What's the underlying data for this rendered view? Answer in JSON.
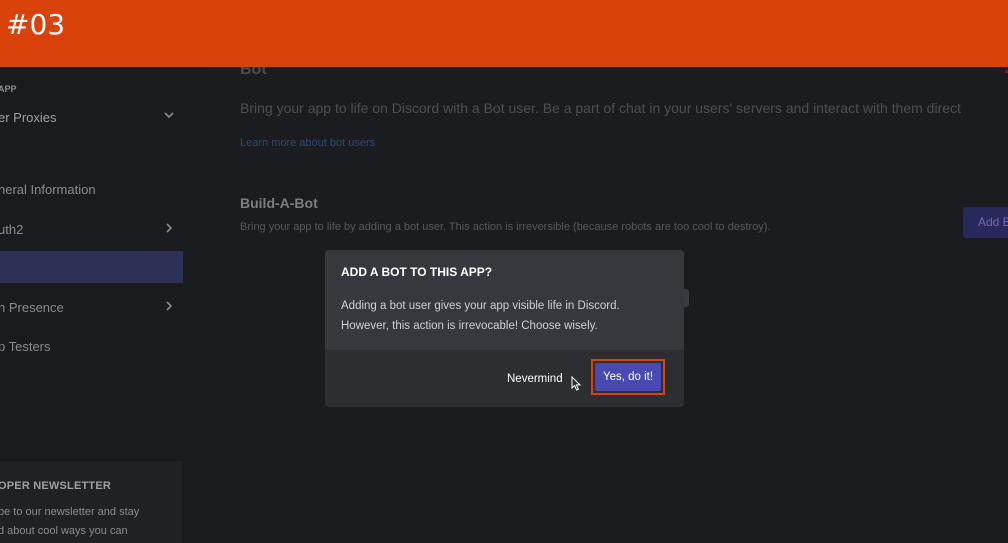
{
  "banner": {
    "text": "#03",
    "color": "#d9420b"
  },
  "sidebar": {
    "app_label": "APP",
    "app_name": "er Proxies",
    "items": [
      {
        "label": "neral Information"
      },
      {
        "label": "uth2"
      },
      {
        "label": ""
      },
      {
        "label": "h Presence"
      },
      {
        "label": "p Testers"
      }
    ],
    "newsletter": {
      "title": "OPER NEWSLETTER",
      "line1": "be to our newsletter and stay",
      "line2": "d about cool ways you can"
    }
  },
  "main": {
    "section_title": "Bot",
    "section_desc": "Bring your app to life on Discord with a Bot user. Be a part of chat in your users' servers and interact with them direct",
    "learn_link": "Learn more about bot users",
    "sub_title": "Build-A-Bot",
    "sub_desc": "Bring your app to life by adding a bot user. This action is irreversible (because robots are too cool to destroy).",
    "add_bot_label": "Add B"
  },
  "modal": {
    "title": "ADD A BOT TO THIS APP?",
    "body_line1": "Adding a bot user gives your app visible life in Discord.",
    "body_line2": "However, this action is irrevocable! Choose wisely.",
    "cancel_label": "Nevermind",
    "confirm_label": "Yes, do it!"
  },
  "colors": {
    "accent": "#4849b3",
    "highlight": "#d9420b",
    "background": "#1b1c1f",
    "modal": "#37383d"
  }
}
